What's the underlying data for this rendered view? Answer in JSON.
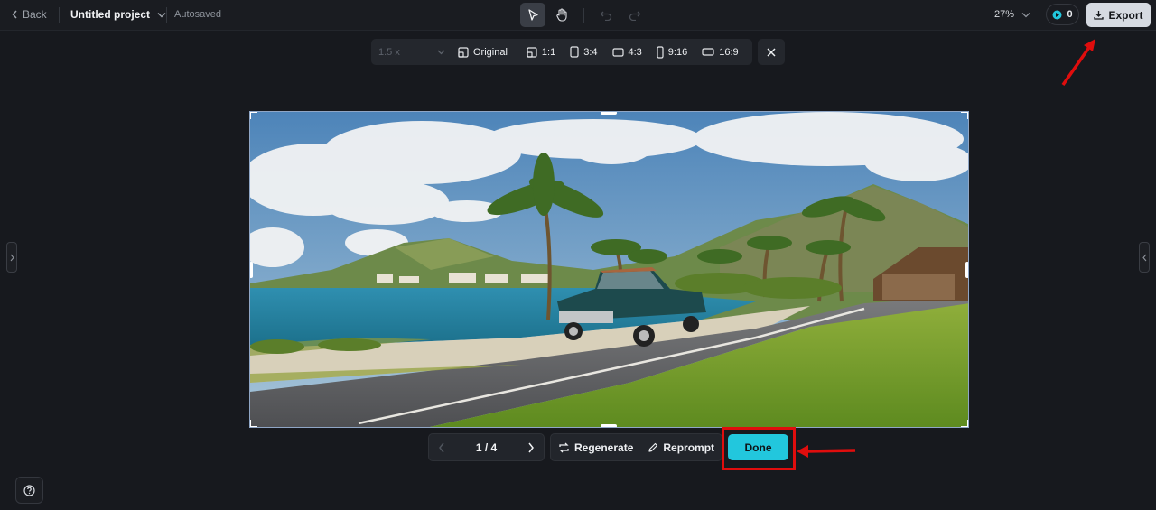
{
  "header": {
    "back_label": "Back",
    "project_title": "Untitled project",
    "save_status": "Autosaved",
    "zoom_level": "27%",
    "credits_count": "0",
    "export_label": "Export"
  },
  "ratio_toolbar": {
    "scale_value": "1.5 x",
    "options": [
      "Original",
      "1:1",
      "3:4",
      "4:3",
      "9:16",
      "16:9"
    ]
  },
  "pager": {
    "current": "1 / 4"
  },
  "actions": {
    "regenerate_label": "Regenerate",
    "reprompt_label": "Reprompt",
    "done_label": "Done"
  },
  "colors": {
    "accent_done": "#22c7dd",
    "annotation_red": "#e00d0d",
    "background": "#17191e"
  },
  "icons": [
    "chevron-left-icon",
    "chevron-down-icon",
    "pointer-icon",
    "hand-icon",
    "undo-icon",
    "redo-icon",
    "credit-icon",
    "download-icon",
    "close-icon",
    "regenerate-icon",
    "pencil-icon",
    "help-icon"
  ]
}
